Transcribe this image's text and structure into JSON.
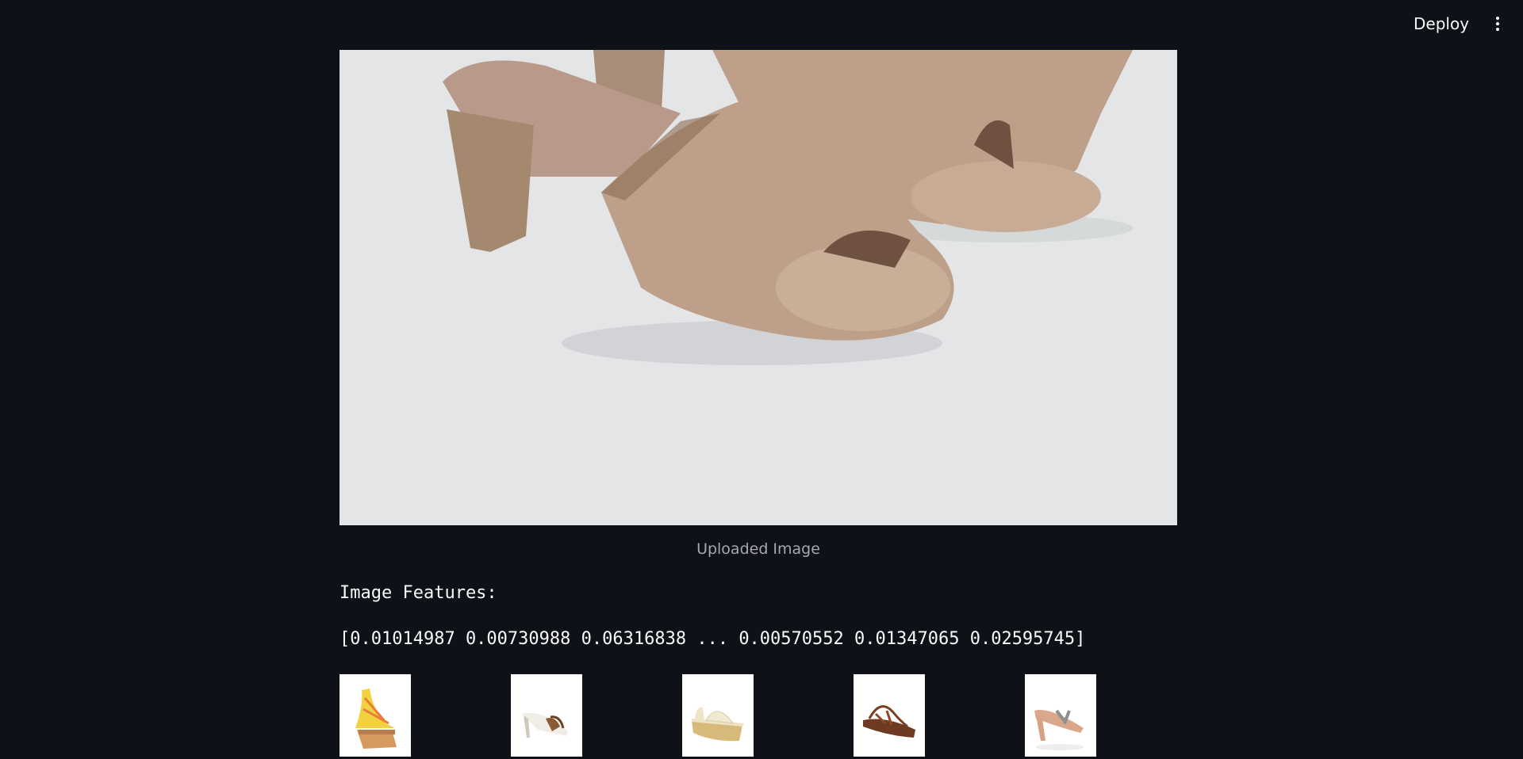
{
  "header": {
    "deploy_label": "Deploy",
    "menu_icon": "three-dots-vertical-icon"
  },
  "main": {
    "uploaded_image_caption": "Uploaded Image",
    "features_label": "Image Features:",
    "features_values": "[0.01014987 0.00730988 0.06316838 ... 0.00570552 0.01347065 0.02595745]"
  },
  "colors": {
    "background": "#0e1117",
    "text": "#fafafa",
    "caption": "#a3a8b4",
    "image_backdrop": "#e3e5e7",
    "shoe": "#bea08a"
  },
  "recommendations": [
    {
      "icon": "yellow-wedge-sandal-icon"
    },
    {
      "icon": "brown-heeled-sandal-icon"
    },
    {
      "icon": "cream-wedge-sandal-icon"
    },
    {
      "icon": "brown-strappy-sandal-icon"
    },
    {
      "icon": "heeled-flip-flop-icon"
    }
  ]
}
